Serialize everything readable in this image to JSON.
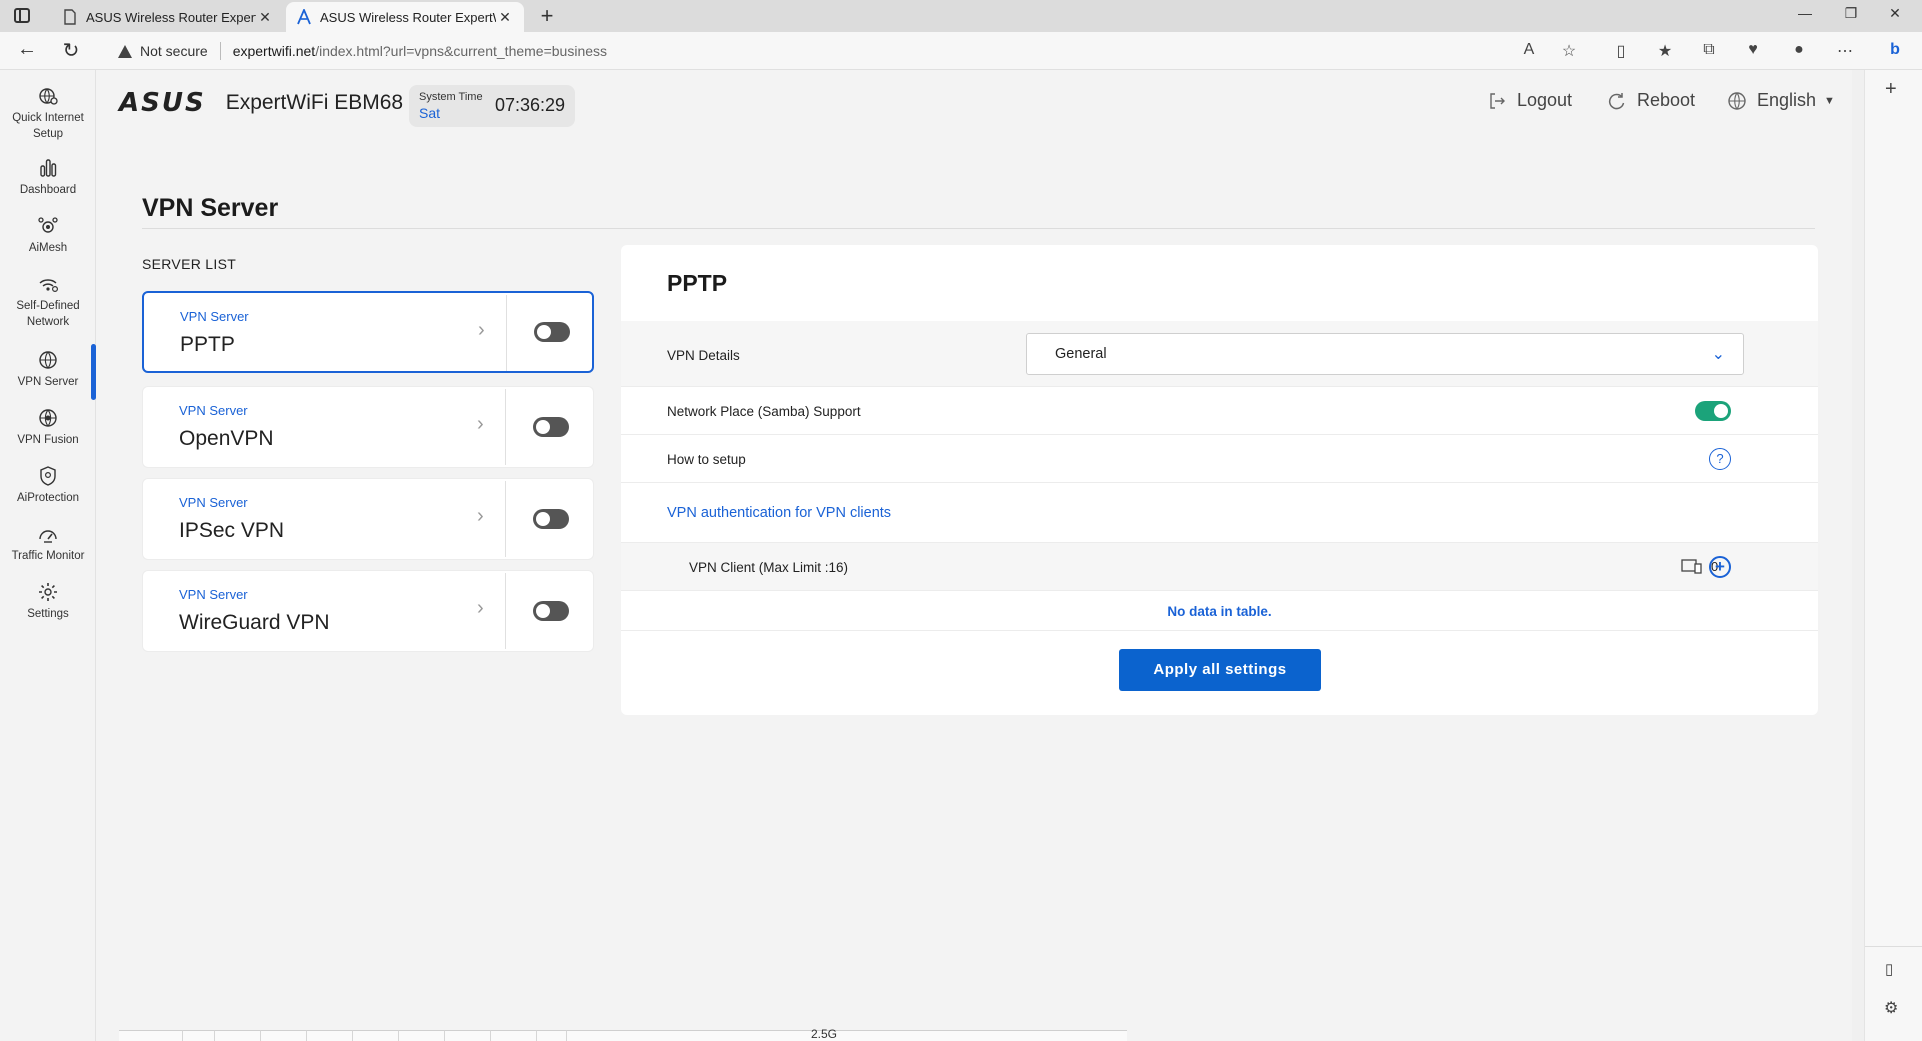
{
  "browser": {
    "tabs": [
      {
        "title": "ASUS Wireless Router ExpertWiFi",
        "active": false
      },
      {
        "title": "ASUS Wireless Router ExpertWiFi",
        "active": true
      }
    ],
    "security_label": "Not secure",
    "url_host": "expertwifi.net",
    "url_path": "/index.html?url=vpns&current_theme=business"
  },
  "nav": {
    "items": [
      {
        "label": "Quick Internet Setup",
        "icon": "globe-gear-icon"
      },
      {
        "label": "Dashboard",
        "icon": "bar-chart-icon"
      },
      {
        "label": "AiMesh",
        "icon": "mesh-icon"
      },
      {
        "label": "Self-Defined Network",
        "icon": "wifi-network-icon"
      },
      {
        "label": "VPN Server",
        "icon": "vpn-globe-icon"
      },
      {
        "label": "VPN Fusion",
        "icon": "vpn-fusion-icon"
      },
      {
        "label": "AiProtection",
        "icon": "shield-icon"
      },
      {
        "label": "Traffic Monitor",
        "icon": "speedometer-icon"
      },
      {
        "label": "Settings",
        "icon": "gear-icon"
      }
    ],
    "active": "VPN Server"
  },
  "header": {
    "brand": "ASUS",
    "model": "ExpertWiFi EBM68",
    "system_time_label": "System Time",
    "system_day": "Sat",
    "system_time": "07:36:29",
    "logout_label": "Logout",
    "reboot_label": "Reboot",
    "language_label": "English"
  },
  "page": {
    "title": "VPN Server",
    "server_list_label": "SERVER LIST",
    "servers": [
      {
        "sub": "VPN Server",
        "name": "PPTP",
        "enabled": false,
        "selected": true
      },
      {
        "sub": "VPN Server",
        "name": "OpenVPN",
        "enabled": false,
        "selected": false
      },
      {
        "sub": "VPN Server",
        "name": "IPSec VPN",
        "enabled": false,
        "selected": false
      },
      {
        "sub": "VPN Server",
        "name": "WireGuard VPN",
        "enabled": false,
        "selected": false
      }
    ]
  },
  "panel": {
    "title": "PPTP",
    "vpn_details_label": "VPN Details",
    "vpn_details_value": "General",
    "samba_label": "Network Place (Samba) Support",
    "samba_enabled": true,
    "how_to_label": "How to setup",
    "auth_link": "VPN authentication for VPN clients",
    "client_label": "VPN Client (Max Limit :16)",
    "client_count": "0",
    "no_data": "No data in table.",
    "apply_label": "Apply all settings"
  },
  "footer_strip": {
    "label": "2.5G"
  },
  "colors": {
    "accent": "#1a62d6",
    "toggle_on": "#1ba37a",
    "toggle_off": "#555555",
    "apply": "#0b63ce"
  }
}
